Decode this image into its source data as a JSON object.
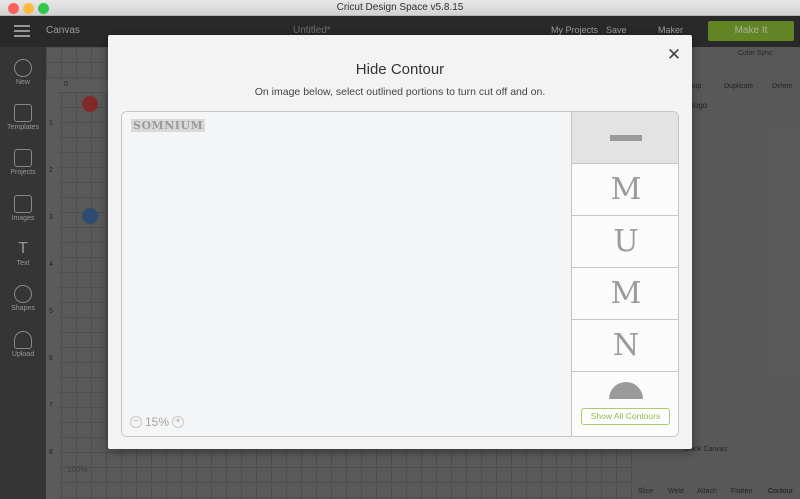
{
  "window": {
    "title": "Cricut Design Space  v5.8.15"
  },
  "appbar": {
    "canvas_label": "Canvas",
    "doc_title": "Untitled*",
    "my_projects": "My Projects",
    "save": "Save",
    "machine": "Maker",
    "make_it": "Make It"
  },
  "sidebar": {
    "items": [
      {
        "label": "New",
        "icon": "plus-icon"
      },
      {
        "label": "Templates",
        "icon": "shirt-icon"
      },
      {
        "label": "Projects",
        "icon": "projects-icon"
      },
      {
        "label": "Images",
        "icon": "image-icon"
      },
      {
        "label": "Text",
        "icon": "text-icon"
      },
      {
        "label": "Shapes",
        "icon": "shapes-icon"
      },
      {
        "label": "Upload",
        "icon": "upload-icon"
      }
    ]
  },
  "canvas": {
    "ruler_top": [
      "0"
    ],
    "ruler_left": [
      "1",
      "2",
      "3",
      "4",
      "5",
      "6",
      "7",
      "8"
    ],
    "zoom": "100%"
  },
  "layers_panel": {
    "color_sync": "Color Sync",
    "actions": [
      "Group",
      "Duplicate",
      "Delete"
    ],
    "layer_name": "logo",
    "blank_canvas": "Blank Canvas",
    "bottom_actions": [
      "Slice",
      "Weld",
      "Attach",
      "Flatten",
      "Contour"
    ]
  },
  "modal": {
    "title": "Hide Contour",
    "subtitle": "On image below, select outlined portions to turn cut off and on.",
    "preview_word": "SOMNIUM",
    "zoom": "15%",
    "contours": [
      {
        "glyph": "—",
        "selected": true
      },
      {
        "glyph": "M",
        "selected": false
      },
      {
        "glyph": "U",
        "selected": false
      },
      {
        "glyph": "M",
        "selected": false
      },
      {
        "glyph": "N",
        "selected": false
      },
      {
        "glyph": "◠",
        "selected": false
      }
    ],
    "show_all_label": "Show All Contours",
    "colors": {
      "accent": "#8cb94a",
      "border": "#c6c6c6"
    }
  }
}
